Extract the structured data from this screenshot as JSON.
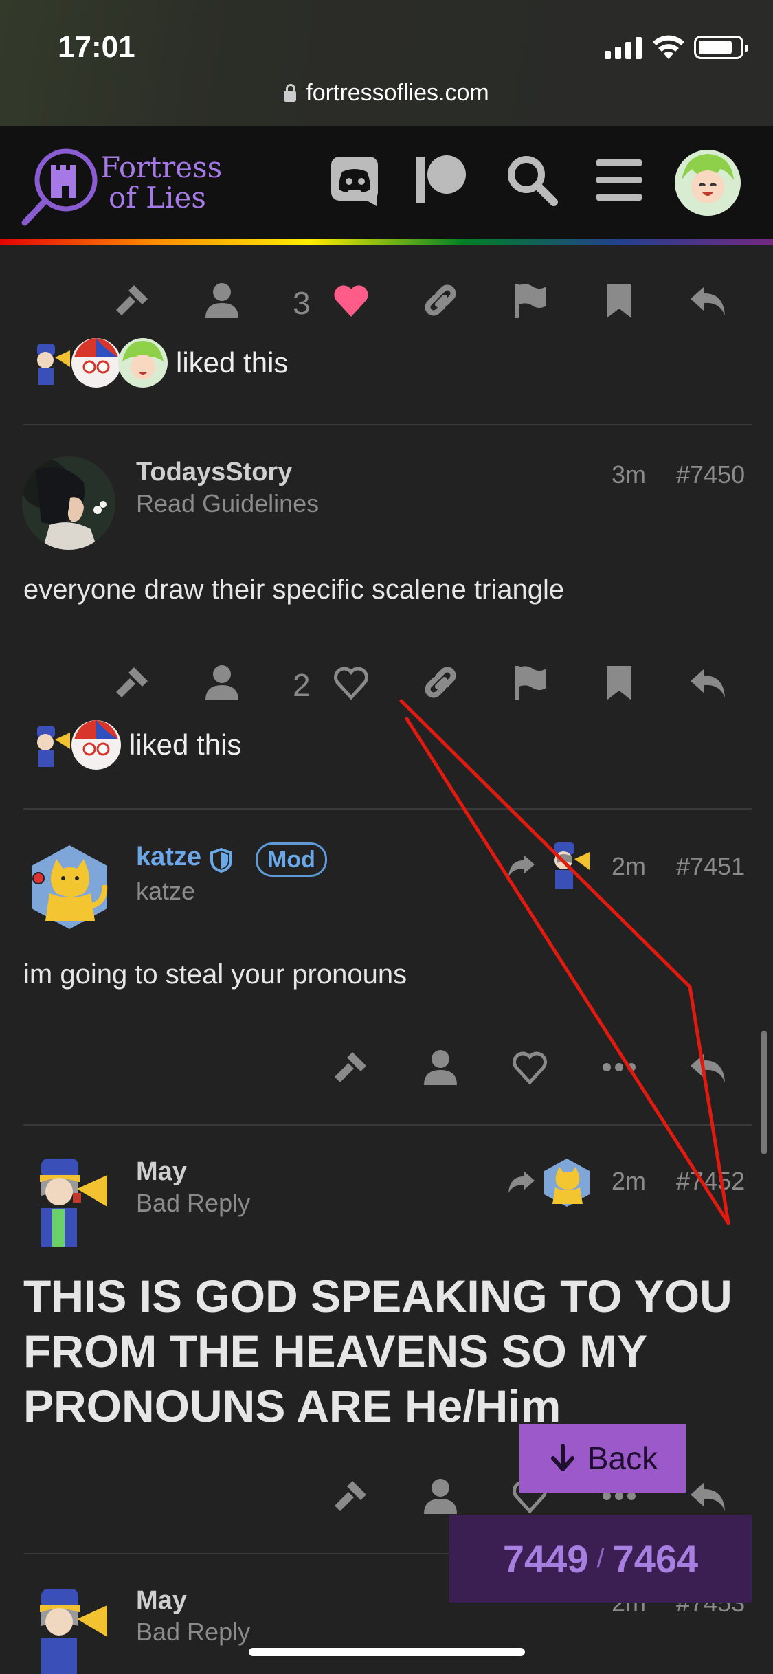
{
  "status_bar": {
    "time": "17:01"
  },
  "browser": {
    "url": "fortressoflies.com"
  },
  "site": {
    "brand_line1": "Fortress",
    "brand_line2": "of Lies",
    "colors": {
      "accent": "#a57ae6",
      "heart": "#ff5c8a",
      "mod": "#6aa8e8",
      "annotation": "#e01a0f"
    }
  },
  "header_icons": [
    "discord-icon",
    "patreon-icon",
    "search-icon",
    "hamburger-menu-icon",
    "user-avatar"
  ],
  "posts": [
    {
      "likes_count": "3",
      "liked_text": "liked this",
      "liked": true
    },
    {
      "username": "TodaysStory",
      "user_title": "Read Guidelines",
      "time": "3m",
      "number": "#7450",
      "body": "everyone draw their specific scalene triangle",
      "likes_count": "2",
      "liked_text": "liked this"
    },
    {
      "username": "katze",
      "badge": "Mod",
      "user_title": "katze",
      "time": "2m",
      "number": "#7451",
      "body": "im going to steal your pronouns"
    },
    {
      "username": "May",
      "user_title": "Bad Reply",
      "time": "2m",
      "number": "#7452",
      "body": "THIS IS GOD SPEAKING TO YOU FROM THE HEAVENS SO MY PRONOUNS ARE He/Him"
    },
    {
      "username": "May",
      "user_title": "Bad Reply",
      "time": "2m",
      "number": "#7453"
    }
  ],
  "floating": {
    "back_label": "Back",
    "progress_current": "7449",
    "progress_sep": "/",
    "progress_total": "7464"
  }
}
